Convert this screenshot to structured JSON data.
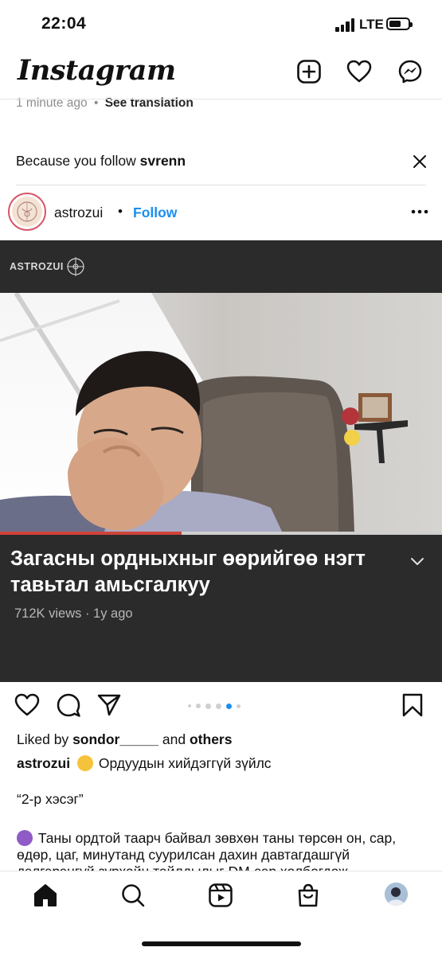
{
  "status_bar": {
    "time": "22:04",
    "network": "LTE"
  },
  "header": {
    "logo": "Instagram",
    "icons": [
      "new-post-icon",
      "heart-icon",
      "messenger-icon"
    ]
  },
  "previous_post": {
    "time_ago": "1 minute ago",
    "separator": "•",
    "see_translation": "See translation"
  },
  "suggestion": {
    "prefix": "Because you follow",
    "account": "svrenn"
  },
  "post": {
    "username": "astrozui",
    "separator": "•",
    "follow_label": "Follow",
    "media": {
      "brand": "ASTROZUI",
      "video_title": "Загасны ордныхныг өөрийгөө нэгт тавьтал амьсгалкуу",
      "meta": "712K views · 1y ago",
      "progress": 0.41
    },
    "carousel": {
      "count": 6,
      "active_index": 4
    },
    "likes": {
      "prefix": "Liked by",
      "user": "sondor_____",
      "middle": "and",
      "suffix": "others"
    },
    "caption": {
      "username": "astrozui",
      "first_line": "Ордуудын хийдэггүй зүйлс",
      "part": "“2-р хэсэг”",
      "line1": "Таны ордтой таарч байвал зөвхөн таны төрсөн он, сар,",
      "line2": "өдөр, цаг, минутанд суурилсан дахин давтагдашгүй",
      "line3": "дэлгэрэнгүй зурхайн тайлдылыг DM-ээр холбогдож"
    }
  },
  "tab_bar": {
    "items": [
      "home-icon",
      "search-icon",
      "reels-icon",
      "shop-icon",
      "profile-avatar"
    ]
  },
  "colors": {
    "follow_blue": "#1a8ef0",
    "progress_red": "#d0433b",
    "media_bg": "#2b2b2b"
  }
}
